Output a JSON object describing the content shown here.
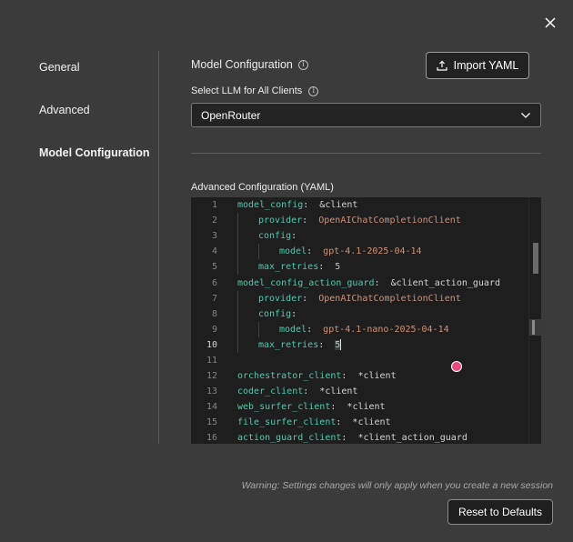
{
  "dialog": {
    "close_icon": "close-icon"
  },
  "sidebar": {
    "items": [
      {
        "label": "General",
        "active": false
      },
      {
        "label": "Advanced",
        "active": false
      },
      {
        "label": "Model Configuration",
        "active": true
      }
    ]
  },
  "main": {
    "section_title": "Model Configuration",
    "import_label": "Import YAML",
    "select_label": "Select LLM for All Clients",
    "selected_llm": "OpenRouter",
    "advanced_label": "Advanced Configuration (YAML)"
  },
  "editor": {
    "lines": [
      {
        "num": "1",
        "parts": [
          [
            "k",
            "model_config"
          ],
          [
            "p",
            ":  &client"
          ]
        ]
      },
      {
        "num": "2",
        "parts": [
          [
            "k",
            "provider"
          ],
          [
            "p",
            ":  "
          ],
          [
            "s",
            "OpenAIChatCompletionClient"
          ]
        ]
      },
      {
        "num": "3",
        "parts": [
          [
            "k",
            "config"
          ],
          [
            "p",
            ":"
          ]
        ]
      },
      {
        "num": "4",
        "parts": [
          [
            "k",
            "model"
          ],
          [
            "p",
            ":  "
          ],
          [
            "s",
            "gpt-4.1-2025-04-14"
          ]
        ]
      },
      {
        "num": "5",
        "parts": [
          [
            "k",
            "max_retries"
          ],
          [
            "p",
            ":  "
          ],
          [
            "n",
            "5"
          ]
        ]
      },
      {
        "num": "6",
        "parts": [
          [
            "k",
            "model_config_action_guard"
          ],
          [
            "p",
            ":  &client_action_guard"
          ]
        ]
      },
      {
        "num": "7",
        "parts": [
          [
            "k",
            "provider"
          ],
          [
            "p",
            ":  "
          ],
          [
            "s",
            "OpenAIChatCompletionClient"
          ]
        ]
      },
      {
        "num": "8",
        "parts": [
          [
            "k",
            "config"
          ],
          [
            "p",
            ":"
          ]
        ]
      },
      {
        "num": "9",
        "parts": [
          [
            "k",
            "model"
          ],
          [
            "p",
            ":  "
          ],
          [
            "s",
            "gpt-4.1-nano-2025-04-14"
          ]
        ]
      },
      {
        "num": "10",
        "parts": [
          [
            "k",
            "max_retries"
          ],
          [
            "p",
            ":  "
          ],
          [
            "n",
            "5"
          ]
        ]
      },
      {
        "num": "11",
        "parts": []
      },
      {
        "num": "12",
        "parts": [
          [
            "k",
            "orchestrator_client"
          ],
          [
            "p",
            ":  *client"
          ]
        ]
      },
      {
        "num": "13",
        "parts": [
          [
            "k",
            "coder_client"
          ],
          [
            "p",
            ":  *client"
          ]
        ]
      },
      {
        "num": "14",
        "parts": [
          [
            "k",
            "web_surfer_client"
          ],
          [
            "p",
            ":  *client"
          ]
        ]
      },
      {
        "num": "15",
        "parts": [
          [
            "k",
            "file_surfer_client"
          ],
          [
            "p",
            ":  *client"
          ]
        ]
      },
      {
        "num": "16",
        "parts": [
          [
            "k",
            "action_guard_client"
          ],
          [
            "p",
            ":  *client_action_guard"
          ]
        ]
      }
    ]
  },
  "footer": {
    "warning": "Warning: Settings changes will only apply when you create a new session",
    "reset_label": "Reset to Defaults"
  }
}
